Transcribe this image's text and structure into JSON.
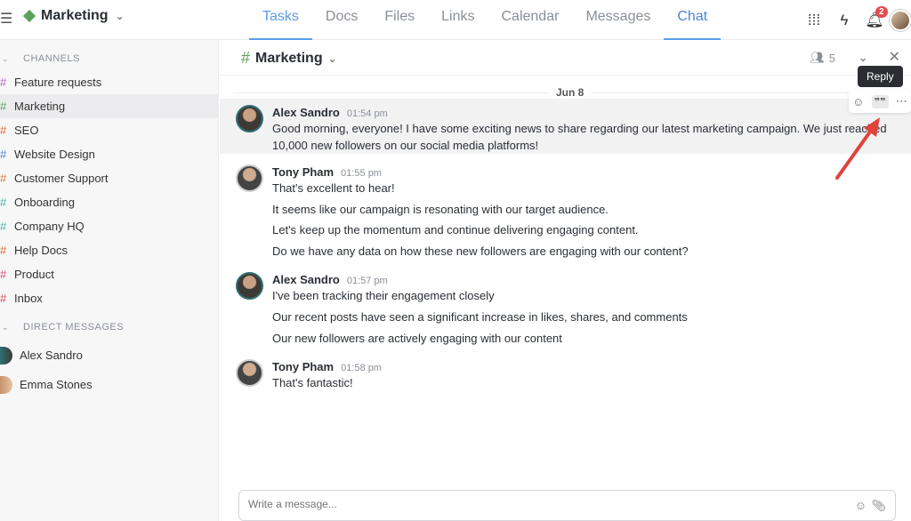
{
  "workspace": {
    "name": "Marketing"
  },
  "nav_tabs": [
    {
      "label": "Tasks"
    },
    {
      "label": "Docs"
    },
    {
      "label": "Files"
    },
    {
      "label": "Links"
    },
    {
      "label": "Calendar"
    },
    {
      "label": "Messages"
    },
    {
      "label": "Chat"
    }
  ],
  "notifications": {
    "count": "2"
  },
  "sidebar": {
    "channels_header": "CHANNELS",
    "channels": [
      {
        "label": "Feature requests",
        "color": "#b26cc7"
      },
      {
        "label": "Marketing",
        "color": "#5aa35a"
      },
      {
        "label": "SEO",
        "color": "#e06c2c"
      },
      {
        "label": "Website Design",
        "color": "#4f7fd1"
      },
      {
        "label": "Customer Support",
        "color": "#e07a39"
      },
      {
        "label": "Onboarding",
        "color": "#4fb3a6"
      },
      {
        "label": "Company HQ",
        "color": "#4fb3a6"
      },
      {
        "label": "Help Docs",
        "color": "#e06c2c"
      },
      {
        "label": "Product",
        "color": "#e04a7a"
      },
      {
        "label": "Inbox",
        "color": "#d94b4b"
      }
    ],
    "dm_header": "DIRECT MESSAGES",
    "direct_messages": [
      {
        "label": "Alex Sandro"
      },
      {
        "label": "Emma Stones"
      }
    ]
  },
  "channel": {
    "name": "Marketing",
    "members": "5"
  },
  "date_divider": "Jun 8",
  "messages": [
    {
      "author": "Alex Sandro",
      "time": "01:54 pm",
      "lines": [
        "Good morning, everyone! I have some exciting news to share regarding our latest marketing campaign. We just reached",
        "10,000 new followers on our social media platforms!"
      ]
    },
    {
      "author": "Tony Pham",
      "time": "01:55 pm",
      "lines": [
        "That's excellent to hear!",
        "It seems like our campaign is resonating with our target audience.",
        "Let's keep up the momentum and continue delivering engaging content.",
        "Do we have any data on how these new followers are engaging with our content?"
      ]
    },
    {
      "author": "Alex Sandro",
      "time": "01:57 pm",
      "lines": [
        "I've been tracking their engagement closely",
        "Our recent posts have seen a significant increase in likes, shares, and comments",
        "Our new followers are actively engaging with our content"
      ]
    },
    {
      "author": "Tony Pham",
      "time": "01:58 pm",
      "lines": [
        "That's fantastic!"
      ]
    }
  ],
  "tooltip": "Reply",
  "composer": {
    "placeholder": "Write a message..."
  }
}
